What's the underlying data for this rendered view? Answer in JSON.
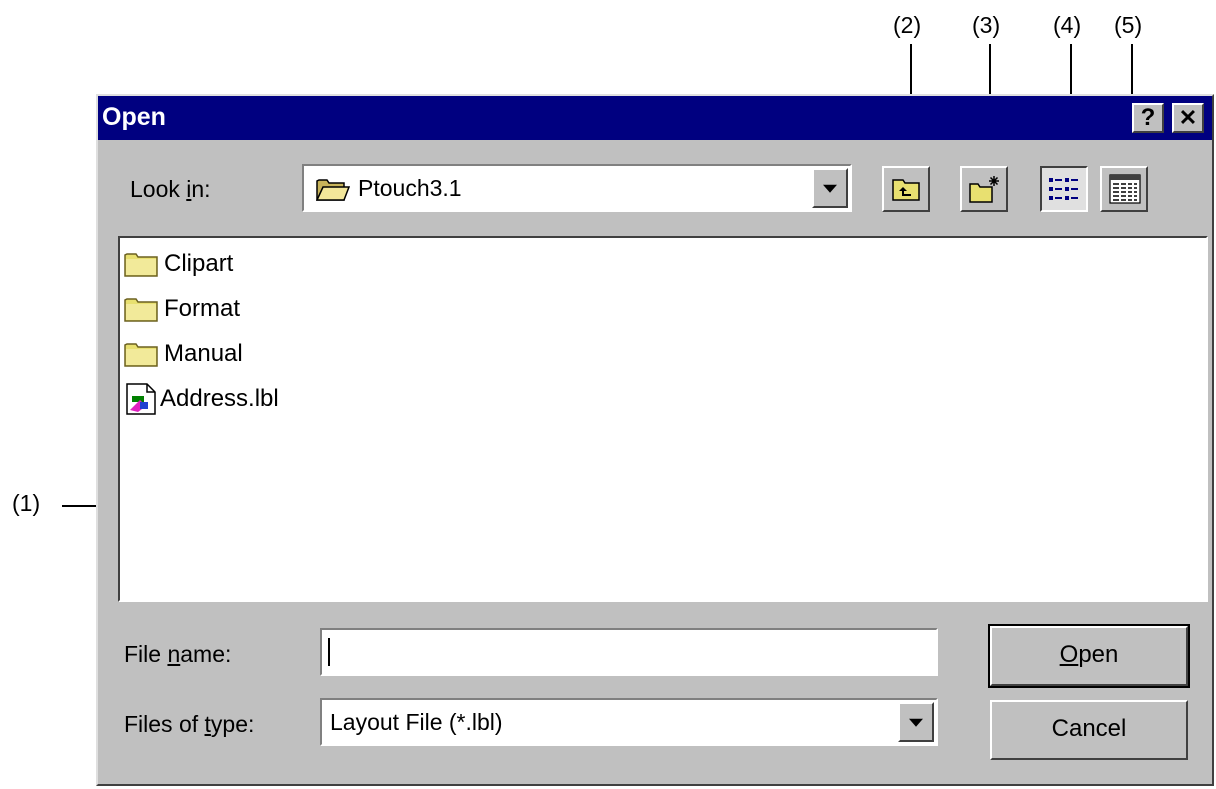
{
  "callouts": {
    "c1": "(1)",
    "c2": "(2)",
    "c3": "(3)",
    "c4": "(4)",
    "c5": "(5)"
  },
  "dialog": {
    "title": "Open",
    "help_label": "?",
    "close_label": "✕",
    "look_in_label_pre": "Look ",
    "look_in_label_key": "i",
    "look_in_label_post": "n:",
    "look_in_value": "Ptouch3.1",
    "toolbar": {
      "up_one_level_icon": "folder-up-icon",
      "new_folder_icon": "new-folder-icon",
      "list_view_icon": "list-view-icon",
      "details_view_icon": "details-view-icon"
    },
    "files": [
      {
        "name": "Clipart",
        "icon": "folder-icon"
      },
      {
        "name": "Format",
        "icon": "folder-icon"
      },
      {
        "name": "Manual",
        "icon": "folder-icon"
      },
      {
        "name": "Address.lbl",
        "icon": "label-file-icon"
      }
    ],
    "file_name_label_pre": "File ",
    "file_name_label_key": "n",
    "file_name_label_post": "ame:",
    "file_name_value": "",
    "files_of_type_label_pre": "Files of ",
    "files_of_type_label_key": "t",
    "files_of_type_label_post": "ype:",
    "files_of_type_value": "Layout File (*.lbl)",
    "open_button_key": "O",
    "open_button_rest": "pen",
    "cancel_button": "Cancel"
  }
}
